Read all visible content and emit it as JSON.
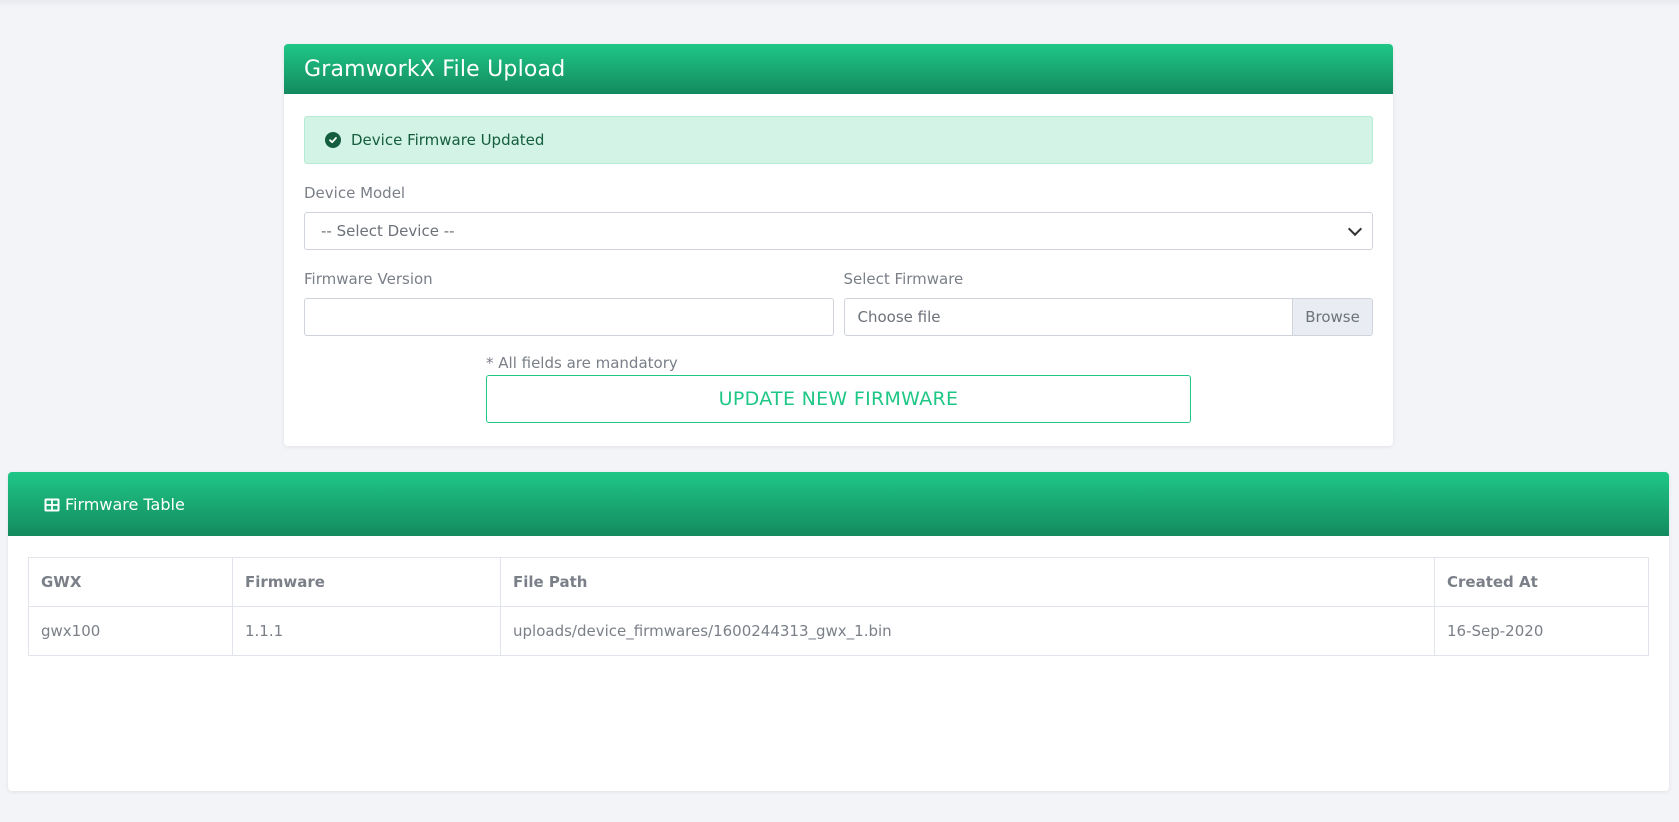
{
  "upload": {
    "title": "GramworkX File Upload",
    "alert_text": "Device Firmware Updated",
    "device_model_label": "Device Model",
    "device_select_value": "-- Select Device --",
    "firmware_version_label": "Firmware Version",
    "firmware_version_value": "",
    "select_firmware_label": "Select Firmware",
    "file_placeholder": "Choose file",
    "browse_label": "Browse",
    "mandatory_note": "* All fields are mandatory",
    "update_button": "UPDATE NEW FIRMWARE"
  },
  "firmware_table": {
    "title": "Firmware Table",
    "columns": [
      "GWX",
      "Firmware",
      "File Path",
      "Created At"
    ],
    "rows": [
      [
        "gwx100",
        "1.1.1",
        "uploads/device_firmwares/1600244313_gwx_1.bin",
        "16-Sep-2020"
      ]
    ]
  },
  "colors": {
    "accent": "#1fc786",
    "accent_dark": "#138a5f",
    "alert_bg": "#d2f3e5",
    "alert_text": "#155d3f"
  },
  "icons": {
    "alert": "check-circle-icon",
    "table": "table-grid-icon",
    "select": "chevron-down-icon"
  }
}
